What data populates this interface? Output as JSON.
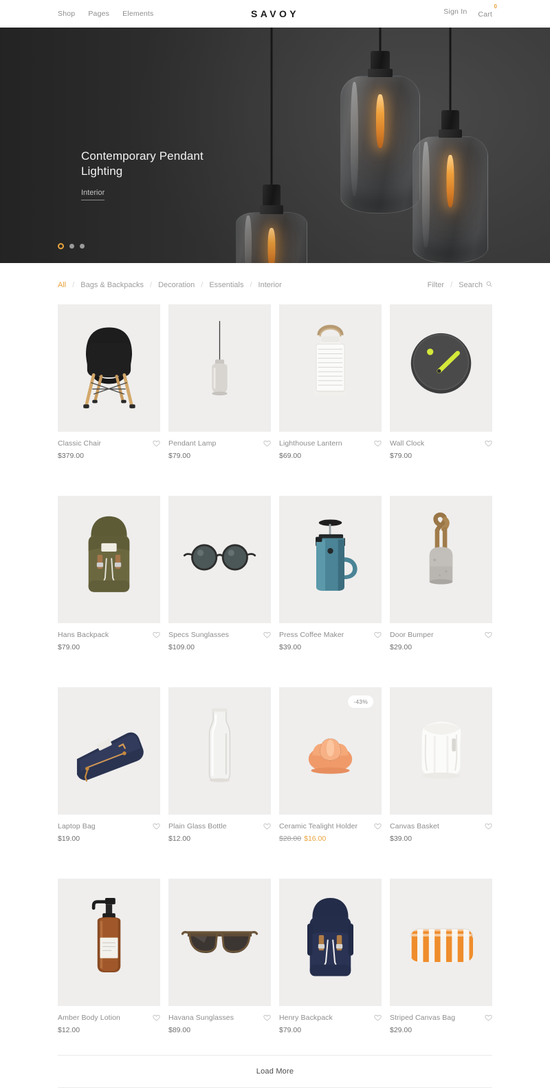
{
  "header": {
    "brand": "SAVOY",
    "nav": [
      {
        "label": "Shop",
        "name": "nav-shop"
      },
      {
        "label": "Pages",
        "name": "nav-pages"
      },
      {
        "label": "Elements",
        "name": "nav-elements"
      }
    ],
    "sign_in": "Sign In",
    "cart": "Cart",
    "cart_count": "0",
    "accent": "#e8a33d"
  },
  "hero": {
    "title": "Contemporary Pendant Lighting",
    "category": "Interior",
    "slides": 3,
    "active_slide": 1,
    "background": "#3a3a3a"
  },
  "filterbar": {
    "categories": [
      {
        "label": "All",
        "active": true
      },
      {
        "label": "Bags & Backpacks",
        "active": false
      },
      {
        "label": "Decoration",
        "active": false
      },
      {
        "label": "Essentials",
        "active": false
      },
      {
        "label": "Interior",
        "active": false
      }
    ],
    "separator": "/",
    "filter_label": "Filter",
    "search_label": "Search"
  },
  "products": [
    {
      "name": "Classic Chair",
      "price": "$379.00",
      "art": "chair"
    },
    {
      "name": "Pendant Lamp",
      "price": "$79.00",
      "art": "pendant"
    },
    {
      "name": "Lighthouse Lantern",
      "price": "$69.00",
      "art": "lantern"
    },
    {
      "name": "Wall Clock",
      "price": "$79.00",
      "art": "clock"
    },
    {
      "name": "Hans Backpack",
      "price": "$79.00",
      "art": "backpack-olive"
    },
    {
      "name": "Specs Sunglasses",
      "price": "$109.00",
      "art": "sunglasses-round"
    },
    {
      "name": "Press Coffee Maker",
      "price": "$39.00",
      "art": "press"
    },
    {
      "name": "Door Bumper",
      "price": "$29.00",
      "art": "bumper"
    },
    {
      "name": "Laptop Bag",
      "price": "$19.00",
      "art": "laptopbag"
    },
    {
      "name": "Plain Glass Bottle",
      "price": "$12.00",
      "art": "bottle"
    },
    {
      "name": "Ceramic Tealight Holder",
      "price": "",
      "old_price": "$28.00",
      "new_price": "$16.00",
      "badge": "-43%",
      "art": "tealight"
    },
    {
      "name": "Canvas Basket",
      "price": "$39.00",
      "art": "basket"
    },
    {
      "name": "Amber Body Lotion",
      "price": "$12.00",
      "art": "lotion"
    },
    {
      "name": "Havana Sunglasses",
      "price": "$89.00",
      "art": "sunglasses-havana"
    },
    {
      "name": "Henry Backpack",
      "price": "$79.00",
      "art": "backpack-navy"
    },
    {
      "name": "Striped Canvas Bag",
      "price": "$29.00",
      "art": "stripedbag"
    }
  ],
  "footer": {
    "load_more": "Load More"
  }
}
